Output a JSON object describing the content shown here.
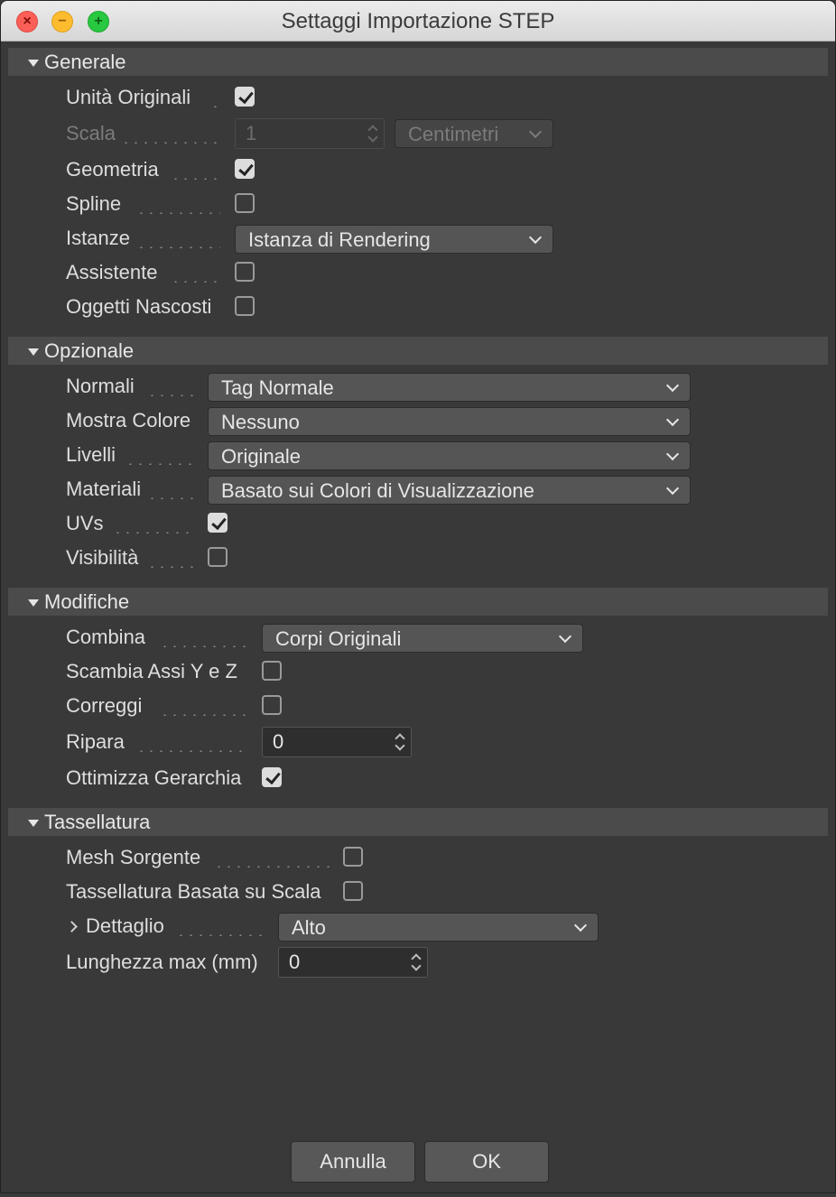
{
  "window": {
    "title": "Settaggi Importazione STEP"
  },
  "sections": {
    "generale": {
      "title": "Generale",
      "unita_originali": {
        "label": "Unità Originali",
        "checked": true
      },
      "scala": {
        "label": "Scala",
        "value": "1",
        "unit": "Centimetri",
        "enabled": false
      },
      "geometria": {
        "label": "Geometria",
        "checked": true
      },
      "spline": {
        "label": "Spline",
        "checked": false
      },
      "istanze": {
        "label": "Istanze",
        "value": "Istanza di Rendering"
      },
      "assistente": {
        "label": "Assistente",
        "checked": false
      },
      "oggetti_nascosti": {
        "label": "Oggetti Nascosti",
        "checked": false
      }
    },
    "opzionale": {
      "title": "Opzionale",
      "normali": {
        "label": "Normali",
        "value": "Tag Normale"
      },
      "mostra_colore": {
        "label": "Mostra Colore",
        "value": "Nessuno"
      },
      "livelli": {
        "label": "Livelli",
        "value": "Originale"
      },
      "materiali": {
        "label": "Materiali",
        "value": "Basato sui Colori di Visualizzazione"
      },
      "uvs": {
        "label": "UVs",
        "checked": true
      },
      "visibilita": {
        "label": "Visibilità",
        "checked": false
      }
    },
    "modifiche": {
      "title": "Modifiche",
      "combina": {
        "label": "Combina",
        "value": "Corpi Originali"
      },
      "scambia_assi": {
        "label": "Scambia Assi Y e Z",
        "checked": false
      },
      "correggi": {
        "label": "Correggi",
        "checked": false
      },
      "ripara": {
        "label": "Ripara",
        "value": "0"
      },
      "ottimizza": {
        "label": "Ottimizza Gerarchia",
        "checked": true
      }
    },
    "tassellatura": {
      "title": "Tassellatura",
      "mesh_sorgente": {
        "label": "Mesh Sorgente",
        "checked": false
      },
      "basata_scala": {
        "label": "Tassellatura Basata su Scala",
        "checked": false
      },
      "dettaglio": {
        "label": "Dettaglio",
        "value": "Alto"
      },
      "lunghezza_max": {
        "label": "Lunghezza max (mm)",
        "value": "0"
      }
    }
  },
  "buttons": {
    "cancel": "Annulla",
    "ok": "OK"
  },
  "icons": {
    "close": "close-icon",
    "minimize": "minimize-icon",
    "maximize": "maximize-icon",
    "section_toggle": "triangle-down-icon",
    "dropdown": "chevron-down-icon",
    "stepper": "stepper-arrows-icon",
    "expander": "chevron-right-icon"
  }
}
